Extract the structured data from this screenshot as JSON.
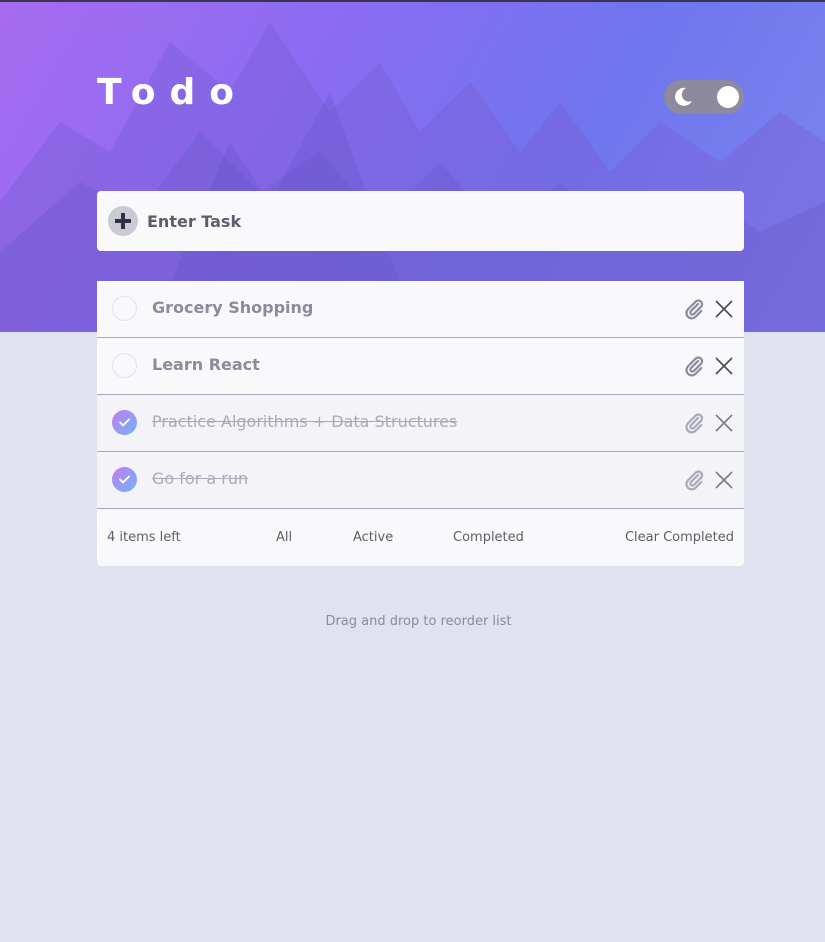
{
  "app": {
    "title": "Todo"
  },
  "theme_toggle": {
    "mode": "light",
    "icon": "moon-icon"
  },
  "entry": {
    "placeholder": "Enter Task",
    "icon": "plus-icon"
  },
  "todos": [
    {
      "text": "Grocery Shopping",
      "completed": false
    },
    {
      "text": "Learn React",
      "completed": false
    },
    {
      "text": "Practice Algorithms + Data Structures",
      "completed": true
    },
    {
      "text": "Go for a run",
      "completed": true
    }
  ],
  "footer": {
    "items_left": "4 items left",
    "filter_all": "All",
    "filter_active": "Active",
    "filter_completed": "Completed",
    "clear_completed": "Clear Completed"
  },
  "hint": "Drag and drop to reorder list",
  "colors": {
    "background": "#e0e2ef",
    "gradient_start": "#a66bf0",
    "gradient_end": "#6f75ee",
    "check_gradient_start": "#c47bf0",
    "check_gradient_end": "#6fb6f7"
  }
}
